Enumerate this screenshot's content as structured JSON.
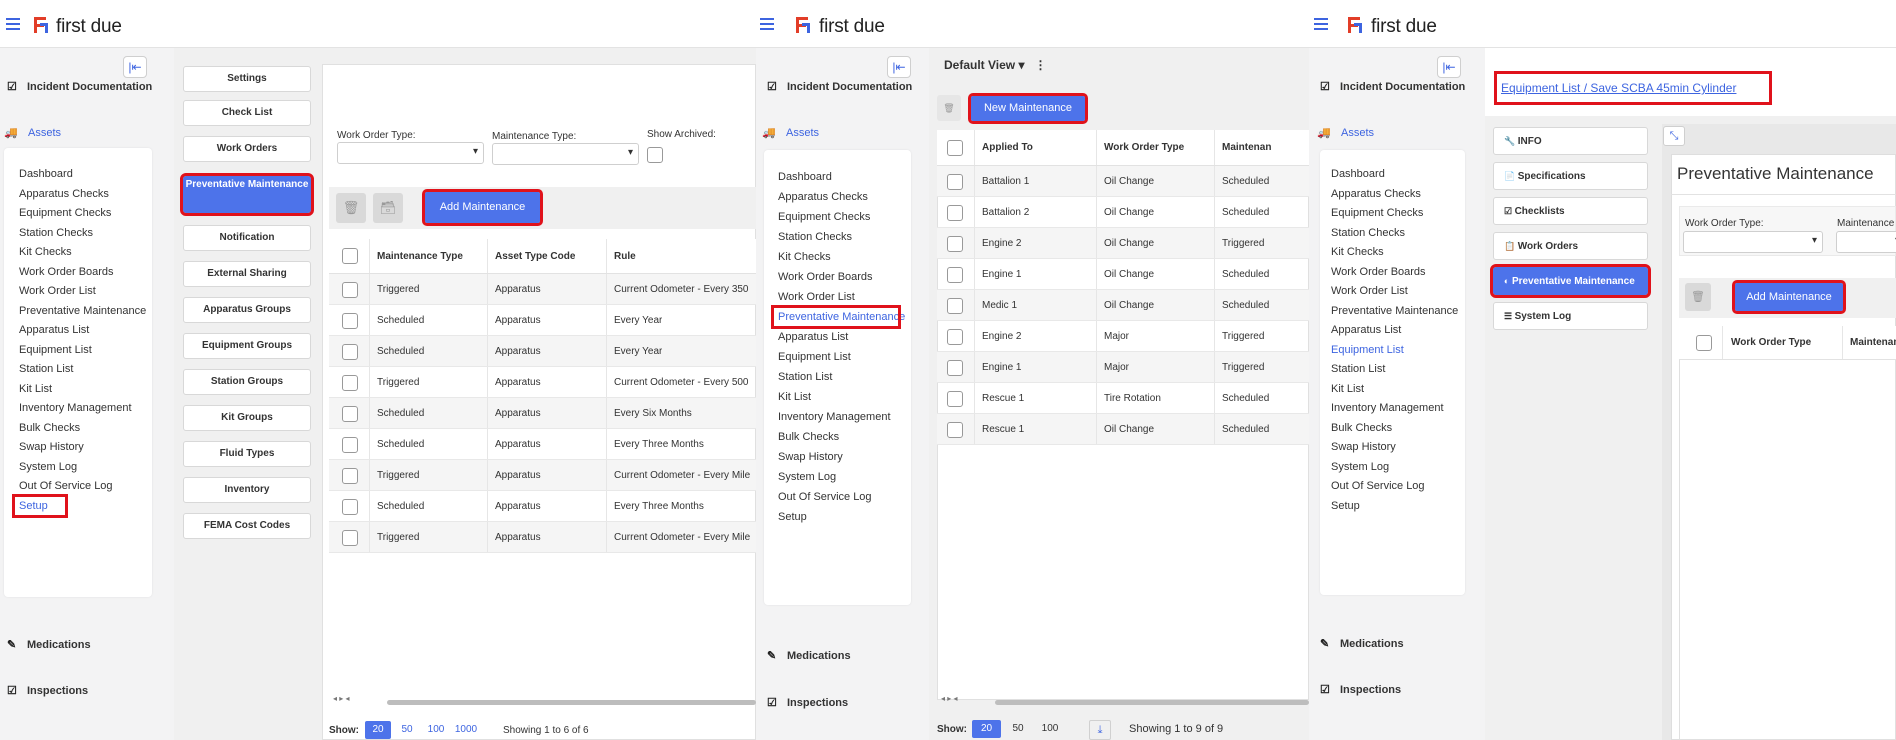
{
  "brand": {
    "name": "first due",
    "accent": "#3d64e0",
    "highlight": "#e0121b"
  },
  "nav": {
    "incident_documentation": "Incident Documentation",
    "assets": "Assets",
    "medications": "Medications",
    "inspections": "Inspections"
  },
  "menu_items": [
    "Dashboard",
    "Apparatus Checks",
    "Equipment Checks",
    "Station Checks",
    "Kit Checks",
    "Work Order Boards",
    "Work Order List",
    "Preventative Maintenance",
    "Apparatus List",
    "Equipment List",
    "Station List",
    "Kit List",
    "Inventory Management",
    "Bulk Checks",
    "Swap History",
    "System Log",
    "Out Of Service Log",
    "Setup"
  ],
  "panel1": {
    "setup_tabs": [
      "Settings",
      "Check List",
      "Work Orders",
      "Preventative Maintenance",
      "Notification",
      "External Sharing",
      "Apparatus Groups",
      "Equipment Groups",
      "Station Groups",
      "Kit Groups",
      "Fluid Types",
      "Inventory",
      "FEMA Cost Codes"
    ],
    "active_tab": "Preventative Maintenance",
    "filters": {
      "work_order_type_label": "Work Order Type:",
      "maintenance_type_label": "Maintenance Type:",
      "show_archived_label": "Show Archived:"
    },
    "add_button": "Add Maintenance",
    "columns": [
      "Maintenance Type",
      "Asset Type Code",
      "Rule"
    ],
    "rows": [
      [
        "Triggered",
        "Apparatus",
        "Current Odometer - Every 350"
      ],
      [
        "Scheduled",
        "Apparatus",
        "Every Year"
      ],
      [
        "Scheduled",
        "Apparatus",
        "Every Year"
      ],
      [
        "Triggered",
        "Apparatus",
        "Current Odometer - Every 500"
      ],
      [
        "Scheduled",
        "Apparatus",
        "Every Six Months"
      ],
      [
        "Scheduled",
        "Apparatus",
        "Every Three Months"
      ],
      [
        "Triggered",
        "Apparatus",
        "Current Odometer - Every Mile"
      ],
      [
        "Scheduled",
        "Apparatus",
        "Every Three Months"
      ],
      [
        "Triggered",
        "Apparatus",
        "Current Odometer - Every Mile"
      ]
    ],
    "show_label": "Show:",
    "page_sizes": [
      "20",
      "50",
      "100",
      "1000"
    ],
    "showing": "Showing 1 to 6 of 6"
  },
  "panel2": {
    "view_label": "Default View",
    "new_button": "New Maintenance",
    "columns": [
      "Applied To",
      "Work Order Type",
      "Maintenan"
    ],
    "rows": [
      [
        "Battalion 1",
        "Oil Change",
        "Scheduled"
      ],
      [
        "Battalion 2",
        "Oil Change",
        "Scheduled"
      ],
      [
        "Engine 2",
        "Oil Change",
        "Triggered"
      ],
      [
        "Engine 1",
        "Oil Change",
        "Scheduled"
      ],
      [
        "Medic 1",
        "Oil Change",
        "Scheduled"
      ],
      [
        "Engine 2",
        "Major",
        "Triggered"
      ],
      [
        "Engine 1",
        "Major",
        "Triggered"
      ],
      [
        "Rescue 1",
        "Tire Rotation",
        "Scheduled"
      ],
      [
        "Rescue 1",
        "Oil Change",
        "Scheduled"
      ]
    ],
    "show_label": "Show:",
    "page_sizes": [
      "20",
      "50",
      "100"
    ],
    "showing": "Showing 1 to 9 of 9"
  },
  "panel3": {
    "breadcrumb": "Equipment List / Save SCBA 45min Cylinder",
    "side_tabs": [
      "INFO",
      "Specifications",
      "Checklists",
      "Work Orders",
      "Preventative Maintenance",
      "System Log"
    ],
    "title": "Preventative Maintenance",
    "work_order_type_label": "Work Order Type:",
    "maintenance_label": "Maintenance",
    "add_button": "Add Maintenance",
    "columns": [
      "Work Order Type",
      "Maintenanc"
    ]
  }
}
